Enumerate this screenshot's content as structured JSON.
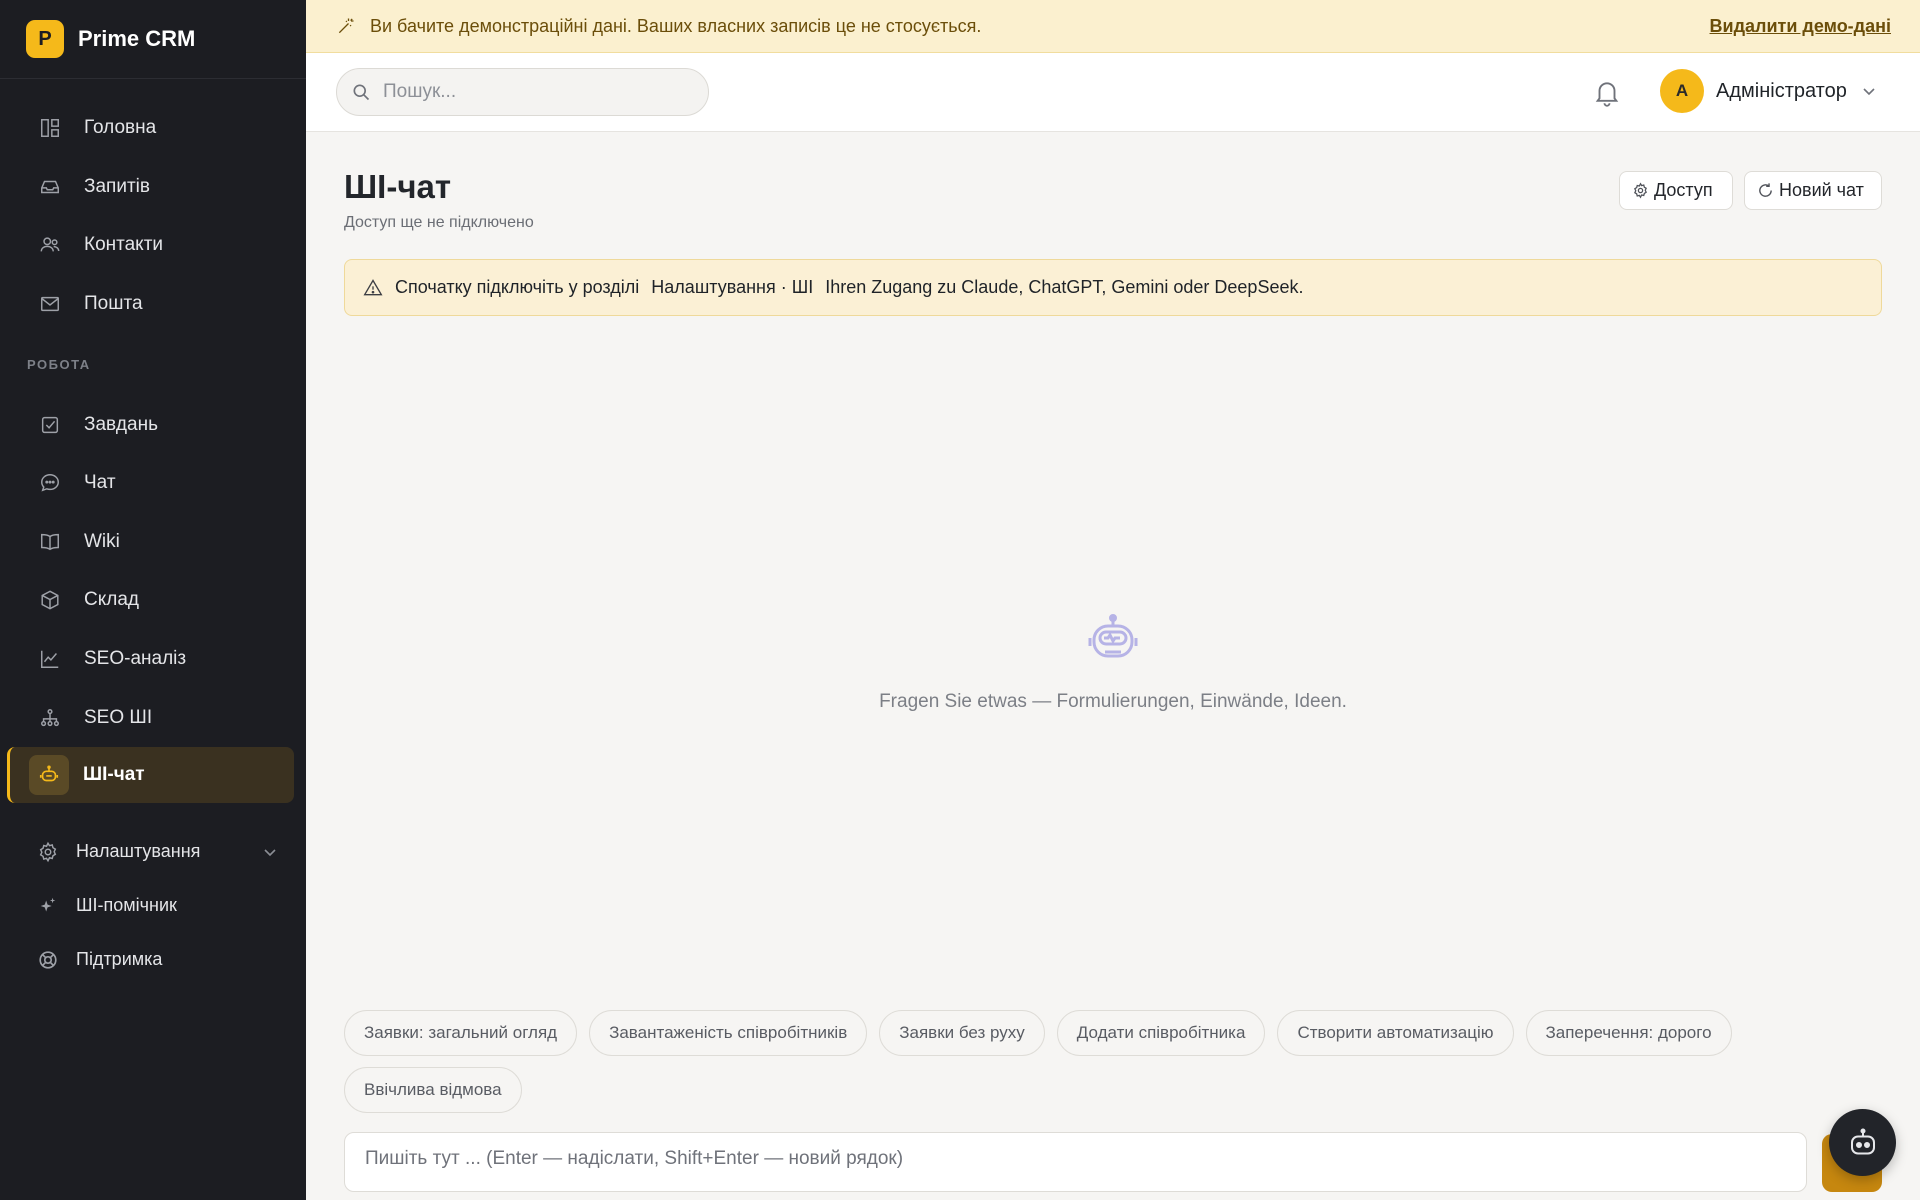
{
  "app": {
    "logo_letter": "P",
    "name": "Prime CRM",
    "accent": "#f5b91a"
  },
  "sidebar": {
    "items_top": [
      {
        "label": "Головна",
        "icon": "dashboard-icon"
      },
      {
        "label": "Запитів",
        "icon": "inbox-icon"
      },
      {
        "label": "Контакти",
        "icon": "users-icon"
      },
      {
        "label": "Пошта",
        "icon": "mail-icon"
      }
    ],
    "section_label": "РОБОТА",
    "items_work": [
      {
        "label": "Завдань",
        "icon": "checkbox-icon"
      },
      {
        "label": "Чат",
        "icon": "chat-bubble-icon"
      },
      {
        "label": "Wiki",
        "icon": "book-icon"
      },
      {
        "label": "Склад",
        "icon": "box-icon"
      },
      {
        "label": "SEO-аналіз",
        "icon": "line-chart-icon"
      },
      {
        "label": "SEO ШІ",
        "icon": "network-icon"
      },
      {
        "label": "ШІ-чат",
        "icon": "robot-icon",
        "active": true
      }
    ],
    "items_bottom": [
      {
        "label": "Налаштування",
        "icon": "gear-icon"
      },
      {
        "label": "ШІ-помічник",
        "icon": "sparkles-icon"
      },
      {
        "label": "Підтримка",
        "icon": "lifebuoy-icon"
      }
    ]
  },
  "demo_banner": {
    "text": "Ви бачите демонстраційні дані. Ваших власних записів це не стосується.",
    "link": "Видалити демо-дані"
  },
  "header": {
    "search_placeholder": "Пошук...",
    "user_initial": "A",
    "user_name": "Адміністратор"
  },
  "main": {
    "title": "ШІ-чат",
    "subtitle": "Доступ ще не підключено",
    "access_button": "Доступ",
    "new_chat_button": "Новий чат",
    "warning": {
      "part1": "Спочатку підключіть у розділі",
      "part2": "Налаштування · ШІ",
      "part3": "Ihren Zugang zu Claude, ChatGPT, Gemini oder DeepSeek."
    },
    "empty_text": "Fragen Sie etwas — Formulierungen, Einwände, Ideen.",
    "chips": [
      "Заявки: загальний огляд",
      "Завантаженість співробітників",
      "Заявки без руху",
      "Додати співробітника",
      "Створити автоматизацію",
      "Заперечення: дорого",
      "Ввічлива відмова"
    ],
    "composer_placeholder": "Пишіть тут ... (Enter — надіслати, Shift+Enter — новий рядок)"
  }
}
